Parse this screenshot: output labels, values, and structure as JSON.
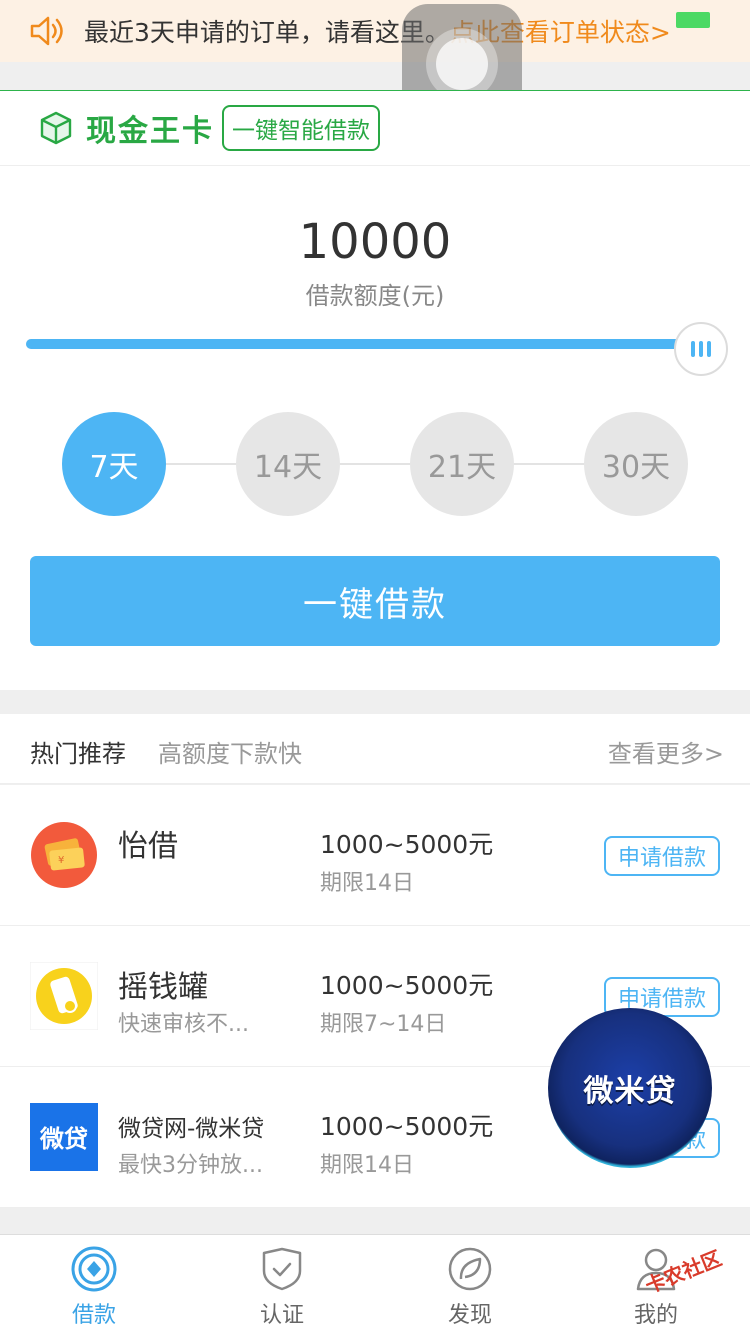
{
  "notice": {
    "text": "最近3天申请的订单，请看这里。",
    "link": "点此查看订单状态>"
  },
  "card": {
    "title": "现金王卡",
    "tag": "一键智能借款"
  },
  "loan": {
    "amount": "10000",
    "amount_label": "借款额度(元)",
    "slider_level": 1.0,
    "days": [
      "7天",
      "14天",
      "21天",
      "30天"
    ],
    "selected_day_index": 0,
    "borrow_button": "一键借款"
  },
  "recommend": {
    "title": "热门推荐",
    "subtitle": "高额度下款快",
    "more": "查看更多>",
    "items": [
      {
        "name": "怡借",
        "desc": "",
        "range": "1000~5000元",
        "term": "期限14日",
        "apply": "申请借款",
        "logo": "yijie-logo"
      },
      {
        "name": "摇钱罐",
        "desc": "快速审核不...",
        "range": "1000~5000元",
        "term": "期限7~14日",
        "apply": "申请借款",
        "logo": "yaoqianguan-logo"
      },
      {
        "name": "微贷网-微米贷",
        "desc": "最快3分钟放...",
        "range": "1000~5000元",
        "term": "期限14日",
        "apply": "申请借款",
        "logo": "weidai-logo",
        "logo_text": "微贷"
      }
    ]
  },
  "badge": {
    "text": "微米贷"
  },
  "tabbar": {
    "tabs": [
      {
        "label": "借款",
        "icon": "loan-icon",
        "active": true
      },
      {
        "label": "认证",
        "icon": "shield-check-icon",
        "active": false
      },
      {
        "label": "发现",
        "icon": "discover-leaf-icon",
        "active": false
      },
      {
        "label": "我的",
        "icon": "user-icon",
        "active": false
      }
    ]
  },
  "watermark": {
    "text": "卡农社区"
  },
  "colors": {
    "primary_blue": "#4db5f4",
    "brand_green": "#29a844",
    "notice_orange": "#f08a1c",
    "notice_bg": "#fdf1e4"
  }
}
